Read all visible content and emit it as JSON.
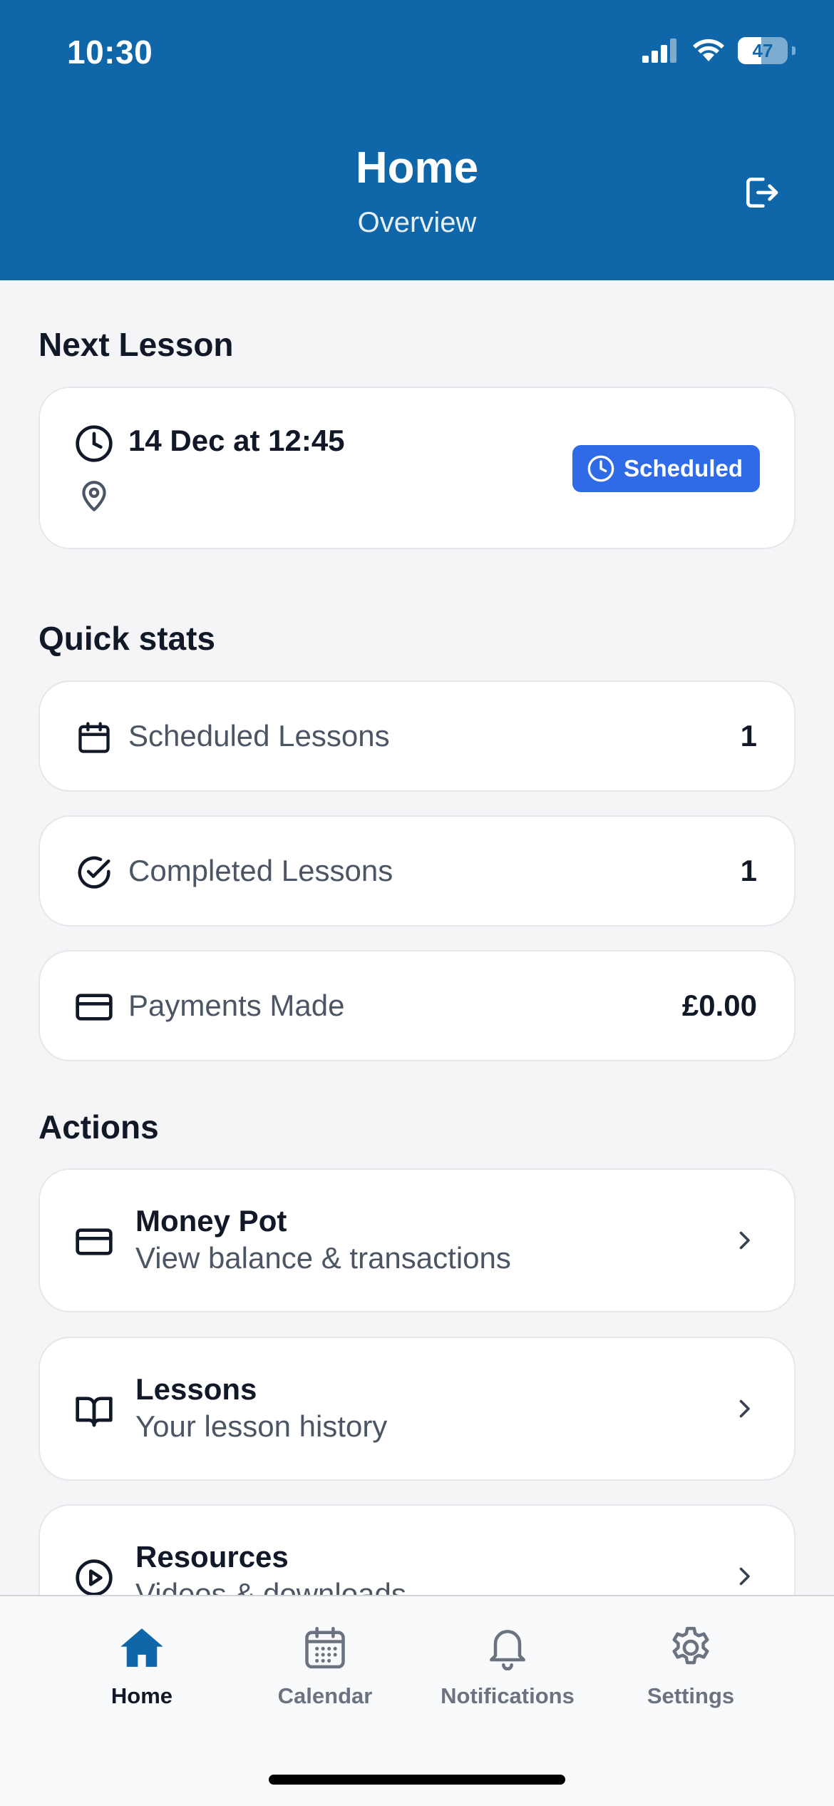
{
  "status_bar": {
    "time": "10:30",
    "battery": "47"
  },
  "header": {
    "title": "Home",
    "subtitle": "Overview"
  },
  "next_lesson": {
    "section_title": "Next Lesson",
    "datetime": "14 Dec at 12:45",
    "location": "",
    "status": "Scheduled"
  },
  "quick_stats": {
    "section_title": "Quick stats",
    "items": [
      {
        "label": "Scheduled Lessons",
        "value": "1",
        "icon": "calendar-icon"
      },
      {
        "label": "Completed Lessons",
        "value": "1",
        "icon": "check-circle-icon"
      },
      {
        "label": "Payments Made",
        "value": "£0.00",
        "icon": "credit-card-icon"
      }
    ]
  },
  "actions": {
    "section_title": "Actions",
    "items": [
      {
        "title": "Money Pot",
        "subtitle": "View balance & transactions",
        "icon": "credit-card-icon"
      },
      {
        "title": "Lessons",
        "subtitle": "Your lesson history",
        "icon": "book-icon"
      },
      {
        "title": "Resources",
        "subtitle": "Videos & downloads",
        "icon": "play-circle-icon"
      }
    ]
  },
  "tabbar": {
    "items": [
      {
        "label": "Home",
        "icon": "home-icon",
        "active": true
      },
      {
        "label": "Calendar",
        "icon": "calendar-icon",
        "active": false
      },
      {
        "label": "Notifications",
        "icon": "bell-icon",
        "active": false
      },
      {
        "label": "Settings",
        "icon": "gear-icon",
        "active": false
      }
    ]
  },
  "colors": {
    "header": "#0f66a8",
    "accent": "#2f6be6",
    "active_tab": "#0f66a8"
  }
}
